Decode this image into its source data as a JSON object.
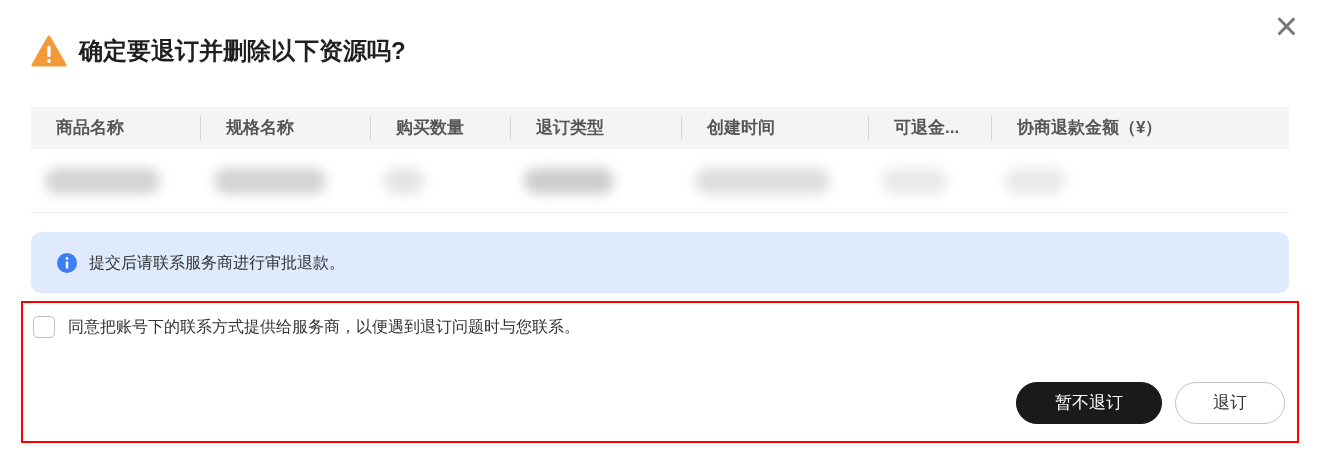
{
  "dialog": {
    "title": "确定要退订并删除以下资源吗?",
    "close": "×"
  },
  "table": {
    "columns": [
      "商品名称",
      "规格名称",
      "购买数量",
      "退订类型",
      "创建时间",
      "可退金...",
      "协商退款金额（¥）"
    ],
    "rows": [
      {
        "cells": [
          {
            "redacted": true
          },
          {
            "redacted": true
          },
          {
            "redacted": true
          },
          {
            "redacted": true
          },
          {
            "redacted": true
          },
          {
            "redacted": true
          },
          {
            "redacted": true
          }
        ]
      }
    ]
  },
  "notice": {
    "text": "提交后请联系服务商进行审批退款。"
  },
  "highlight": {
    "shown": true
  },
  "consent": {
    "label": "同意把账号下的联系方式提供给服务商，以便遇到退订问题时与您联系。",
    "checked": false
  },
  "buttons": [
    {
      "label": "暂不退订",
      "kind": "primary"
    },
    {
      "label": "退订",
      "kind": "secondary"
    }
  ]
}
